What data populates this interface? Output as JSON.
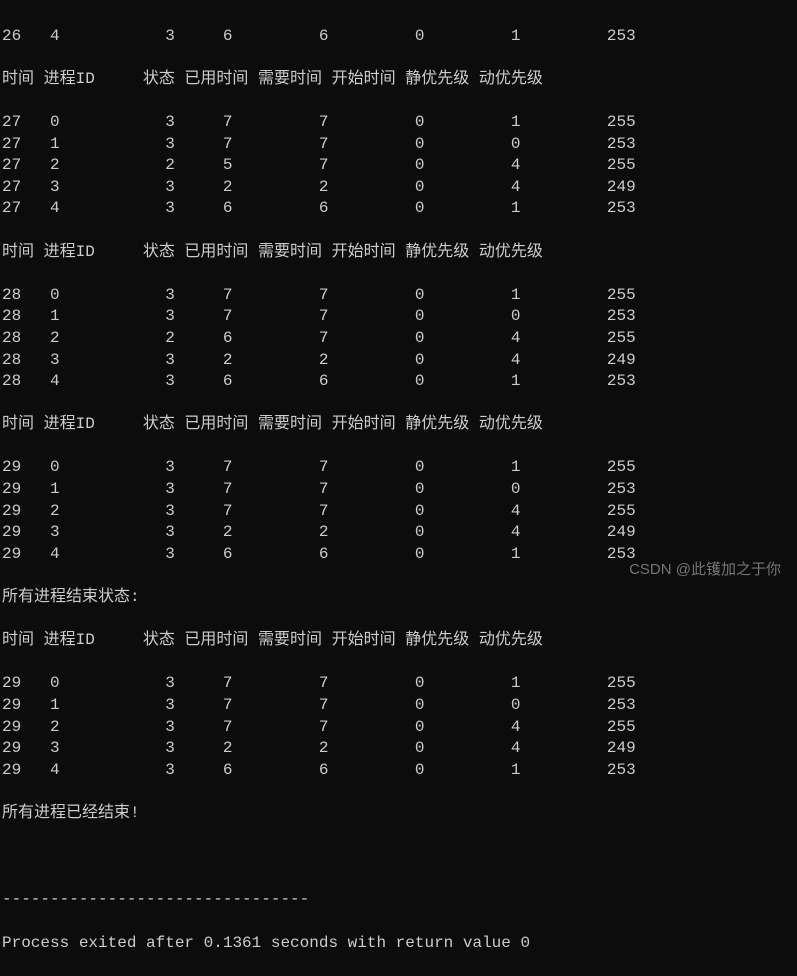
{
  "headers": {
    "time": "时间",
    "pid": "进程ID",
    "state": "状态",
    "used": "已用时间",
    "need": "需要时间",
    "start": "开始时间",
    "sprio": "静优先级",
    "dprio": "动优先级"
  },
  "labels": {
    "all_end_state": "所有进程结束状态:",
    "all_finished": "所有进程已经结束!",
    "divider": "--------------------------------",
    "exit_msg": "Process exited after 0.1361 seconds with return value 0"
  },
  "rows": {
    "r0": [
      "26",
      "4",
      "3",
      "6",
      "6",
      "0",
      "1",
      "253"
    ],
    "h1": true,
    "b1": [
      [
        "27",
        "0",
        "3",
        "7",
        "7",
        "0",
        "1",
        "255"
      ],
      [
        "27",
        "1",
        "3",
        "7",
        "7",
        "0",
        "0",
        "253"
      ],
      [
        "27",
        "2",
        "2",
        "5",
        "7",
        "0",
        "4",
        "255"
      ],
      [
        "27",
        "3",
        "3",
        "2",
        "2",
        "0",
        "4",
        "249"
      ],
      [
        "27",
        "4",
        "3",
        "6",
        "6",
        "0",
        "1",
        "253"
      ]
    ],
    "h2": true,
    "b2": [
      [
        "28",
        "0",
        "3",
        "7",
        "7",
        "0",
        "1",
        "255"
      ],
      [
        "28",
        "1",
        "3",
        "7",
        "7",
        "0",
        "0",
        "253"
      ],
      [
        "28",
        "2",
        "2",
        "6",
        "7",
        "0",
        "4",
        "255"
      ],
      [
        "28",
        "3",
        "3",
        "2",
        "2",
        "0",
        "4",
        "249"
      ],
      [
        "28",
        "4",
        "3",
        "6",
        "6",
        "0",
        "1",
        "253"
      ]
    ],
    "h3": true,
    "b3": [
      [
        "29",
        "0",
        "3",
        "7",
        "7",
        "0",
        "1",
        "255"
      ],
      [
        "29",
        "1",
        "3",
        "7",
        "7",
        "0",
        "0",
        "253"
      ],
      [
        "29",
        "2",
        "3",
        "7",
        "7",
        "0",
        "4",
        "255"
      ],
      [
        "29",
        "3",
        "3",
        "2",
        "2",
        "0",
        "4",
        "249"
      ],
      [
        "29",
        "4",
        "3",
        "6",
        "6",
        "0",
        "1",
        "253"
      ]
    ],
    "h4": true,
    "b4": [
      [
        "29",
        "0",
        "3",
        "7",
        "7",
        "0",
        "1",
        "255"
      ],
      [
        "29",
        "1",
        "3",
        "7",
        "7",
        "0",
        "0",
        "253"
      ],
      [
        "29",
        "2",
        "3",
        "7",
        "7",
        "0",
        "4",
        "255"
      ],
      [
        "29",
        "3",
        "3",
        "2",
        "2",
        "0",
        "4",
        "249"
      ],
      [
        "29",
        "4",
        "3",
        "6",
        "6",
        "0",
        "1",
        "253"
      ]
    ]
  },
  "watermark": "CSDN @此镬加之于你"
}
